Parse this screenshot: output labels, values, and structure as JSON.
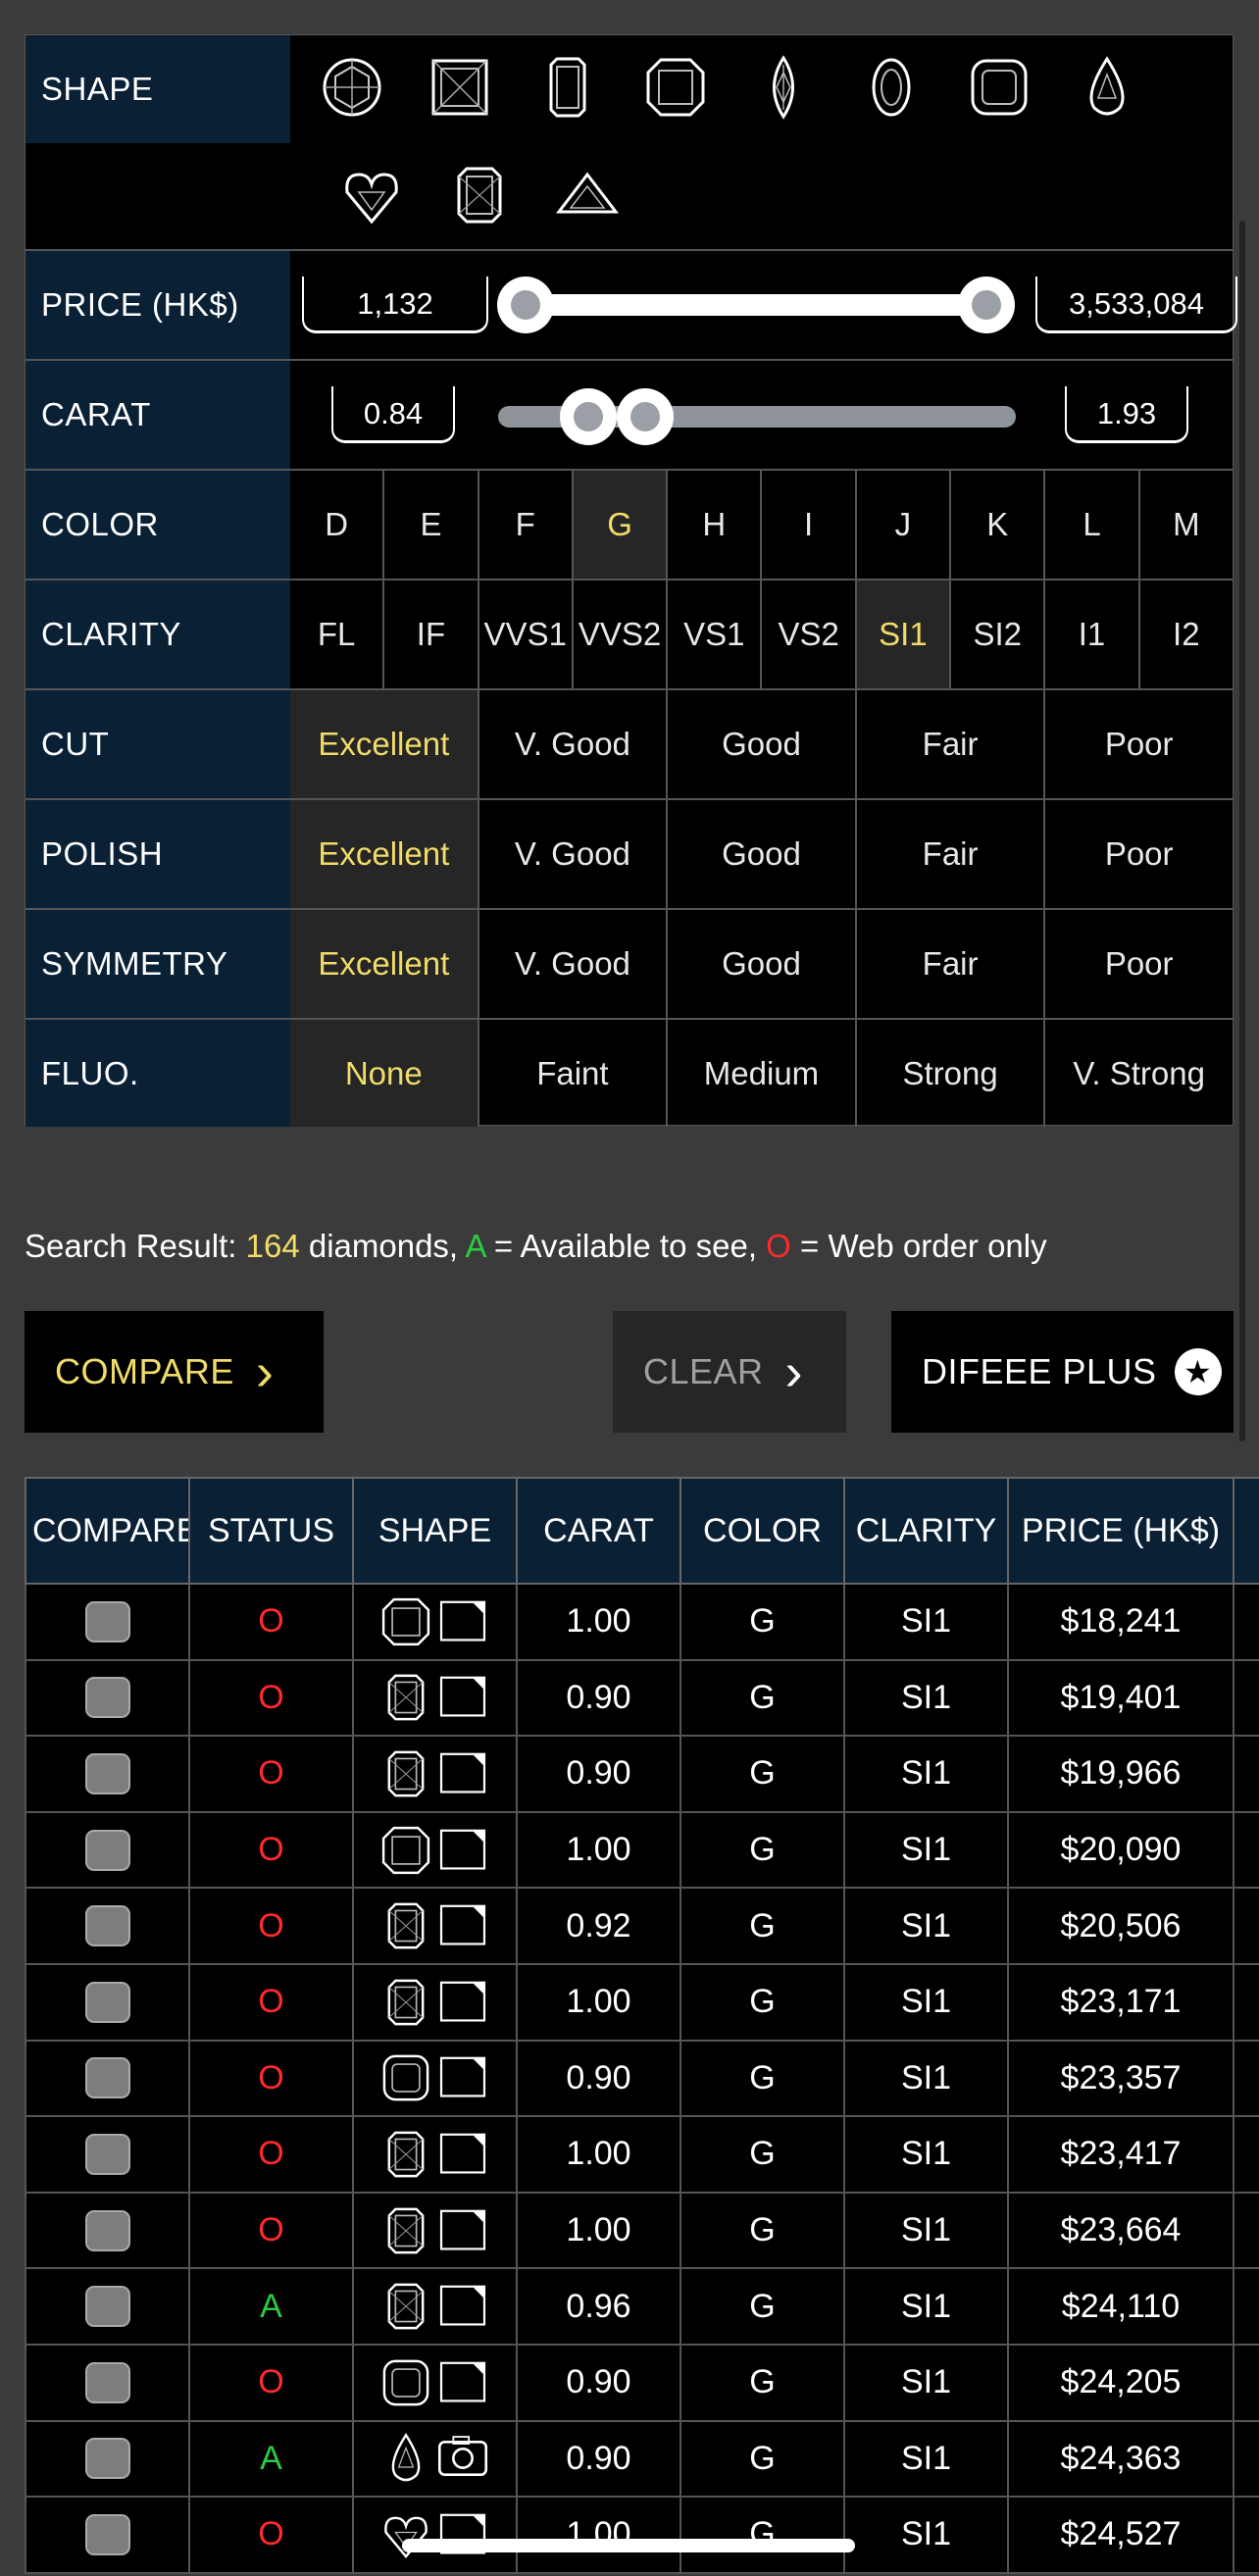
{
  "filters": {
    "shape": {
      "label": "SHAPE",
      "icons": [
        "round-shape-icon",
        "princess-shape-icon",
        "emerald-shape-icon",
        "asscher-shape-icon",
        "marquise-shape-icon",
        "oval-shape-icon",
        "cushion-shape-icon",
        "pear-shape-icon",
        "heart-shape-icon",
        "radiant-shape-icon",
        "trillion-shape-icon"
      ]
    },
    "price": {
      "label": "PRICE (HK$)",
      "min_value": "1,132",
      "max_value": "3,533,084",
      "range_fraction": [
        0.0,
        1.0
      ]
    },
    "carat": {
      "label": "CARAT",
      "min_value": "0.84",
      "max_value": "1.93",
      "range_fraction": [
        0.12,
        0.23
      ]
    },
    "color": {
      "label": "COLOR",
      "options": [
        "D",
        "E",
        "F",
        "G",
        "H",
        "I",
        "J",
        "K",
        "L",
        "M"
      ],
      "selected": "G"
    },
    "clarity": {
      "label": "CLARITY",
      "options": [
        "FL",
        "IF",
        "VVS1",
        "VVS2",
        "VS1",
        "VS2",
        "SI1",
        "SI2",
        "I1",
        "I2"
      ],
      "selected": "SI1"
    },
    "cut": {
      "label": "CUT",
      "options": [
        "Excellent",
        "V. Good",
        "Good",
        "Fair",
        "Poor"
      ],
      "selected": "Excellent"
    },
    "polish": {
      "label": "POLISH",
      "options": [
        "Excellent",
        "V. Good",
        "Good",
        "Fair",
        "Poor"
      ],
      "selected": "Excellent"
    },
    "symmetry": {
      "label": "SYMMETRY",
      "options": [
        "Excellent",
        "V. Good",
        "Good",
        "Fair",
        "Poor"
      ],
      "selected": "Excellent"
    },
    "fluo": {
      "label": "FLUO.",
      "options": [
        "None",
        "Faint",
        "Medium",
        "Strong",
        "V. Strong"
      ],
      "selected": "None"
    }
  },
  "search_result": {
    "prefix": "Search Result: ",
    "count": "164",
    "middle": " diamonds, ",
    "a_letter": "A",
    "a_text": " = Available to see, ",
    "o_letter": "O",
    "o_text": " = Web order only"
  },
  "buttons": {
    "compare": "COMPARE",
    "clear": "CLEAR",
    "plus": "DIFEEE PLUS"
  },
  "colors": {
    "accent_yellow": "#f1dc6a",
    "available_green": "#2ecc40",
    "web_order_red": "#ff2a2a",
    "label_navy": "#0a2035"
  },
  "table": {
    "headers": [
      "COMPARE",
      "STATUS",
      "SHAPE",
      "CARAT",
      "COLOR",
      "CLARITY",
      "PRICE (HK$)"
    ],
    "rows": [
      {
        "status": "O",
        "shape": "asscher",
        "carat": "1.00",
        "color": "G",
        "clarity": "SI1",
        "price": "$18,241"
      },
      {
        "status": "O",
        "shape": "radiant",
        "carat": "0.90",
        "color": "G",
        "clarity": "SI1",
        "price": "$19,401"
      },
      {
        "status": "O",
        "shape": "radiant",
        "carat": "0.90",
        "color": "G",
        "clarity": "SI1",
        "price": "$19,966"
      },
      {
        "status": "O",
        "shape": "asscher",
        "carat": "1.00",
        "color": "G",
        "clarity": "SI1",
        "price": "$20,090"
      },
      {
        "status": "O",
        "shape": "radiant",
        "carat": "0.92",
        "color": "G",
        "clarity": "SI1",
        "price": "$20,506"
      },
      {
        "status": "O",
        "shape": "radiant",
        "carat": "1.00",
        "color": "G",
        "clarity": "SI1",
        "price": "$23,171"
      },
      {
        "status": "O",
        "shape": "cushion",
        "carat": "0.90",
        "color": "G",
        "clarity": "SI1",
        "price": "$23,357"
      },
      {
        "status": "O",
        "shape": "radiant",
        "carat": "1.00",
        "color": "G",
        "clarity": "SI1",
        "price": "$23,417"
      },
      {
        "status": "O",
        "shape": "radiant",
        "carat": "1.00",
        "color": "G",
        "clarity": "SI1",
        "price": "$23,664"
      },
      {
        "status": "A",
        "shape": "radiant",
        "carat": "0.96",
        "color": "G",
        "clarity": "SI1",
        "price": "$24,110"
      },
      {
        "status": "O",
        "shape": "cushion",
        "carat": "0.90",
        "color": "G",
        "clarity": "SI1",
        "price": "$24,205"
      },
      {
        "status": "A",
        "shape": "pear",
        "carat": "0.90",
        "color": "G",
        "clarity": "SI1",
        "price": "$24,363"
      },
      {
        "status": "O",
        "shape": "heart",
        "carat": "1.00",
        "color": "G",
        "clarity": "SI1",
        "price": "$24,527"
      }
    ]
  }
}
